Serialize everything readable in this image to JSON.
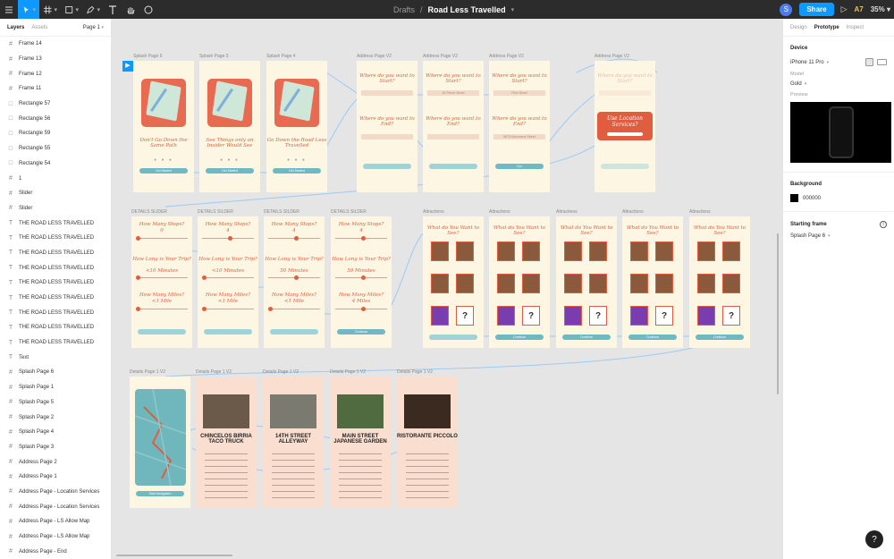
{
  "topbar": {
    "breadcrumb_parent": "Drafts",
    "separator": "/",
    "file_title": "Road Less Travelled",
    "avatar_letter": "S",
    "share_label": "Share",
    "play_glyph": "▷",
    "user_initials": "A7",
    "zoom": "35%"
  },
  "left_panel": {
    "tabs": [
      "Layers",
      "Assets"
    ],
    "page_select": "Page 1",
    "layers": [
      {
        "icon": "frame",
        "label": "Frame 14"
      },
      {
        "icon": "frame",
        "label": "Frame 13"
      },
      {
        "icon": "frame",
        "label": "Frame 12"
      },
      {
        "icon": "frame",
        "label": "Frame 11"
      },
      {
        "icon": "rect",
        "label": "Rectangle 57"
      },
      {
        "icon": "rect",
        "label": "Rectangle 56"
      },
      {
        "icon": "rect",
        "label": "Rectangle 59"
      },
      {
        "icon": "rect",
        "label": "Rectangle 55"
      },
      {
        "icon": "rect",
        "label": "Rectangle 54"
      },
      {
        "icon": "frame",
        "label": "1"
      },
      {
        "icon": "frame",
        "label": "Slider"
      },
      {
        "icon": "frame",
        "label": "Slider"
      },
      {
        "icon": "text",
        "label": "THE ROAD LESS TRAVELLED"
      },
      {
        "icon": "text",
        "label": "THE ROAD LESS TRAVELLED"
      },
      {
        "icon": "text",
        "label": "THE ROAD LESS TRAVELLED"
      },
      {
        "icon": "text",
        "label": "THE ROAD LESS TRAVELLED"
      },
      {
        "icon": "text",
        "label": "THE ROAD LESS TRAVELLED"
      },
      {
        "icon": "text",
        "label": "THE ROAD LESS TRAVELLED"
      },
      {
        "icon": "text",
        "label": "THE ROAD LESS TRAVELLED"
      },
      {
        "icon": "text",
        "label": "THE ROAD LESS TRAVELLED"
      },
      {
        "icon": "text",
        "label": "THE ROAD LESS TRAVELLED"
      },
      {
        "icon": "text",
        "label": "Text"
      },
      {
        "icon": "frame",
        "label": "Splash Page 6"
      },
      {
        "icon": "frame",
        "label": "Splash Page 1"
      },
      {
        "icon": "frame",
        "label": "Splash Page 5"
      },
      {
        "icon": "frame",
        "label": "Splash Page 2"
      },
      {
        "icon": "frame",
        "label": "Splash Page 4"
      },
      {
        "icon": "frame",
        "label": "Splash Page 3"
      },
      {
        "icon": "frame",
        "label": "Address Page 2"
      },
      {
        "icon": "frame",
        "label": "Address Page 1"
      },
      {
        "icon": "frame",
        "label": "Address Page - Location Services"
      },
      {
        "icon": "frame",
        "label": "Address Page - Location Services"
      },
      {
        "icon": "frame",
        "label": "Address Page - LS Allow Map"
      },
      {
        "icon": "frame",
        "label": "Address Page - LS Allow Map"
      },
      {
        "icon": "frame",
        "label": "Address Page - End"
      }
    ]
  },
  "canvas": {
    "row1": [
      {
        "label": "Splash Page 6",
        "caption": "Don't Go Down the Same Path",
        "button": "Get Started"
      },
      {
        "label": "Splash Page 5",
        "caption": "See Things only an Insider Would See",
        "button": "Get Started"
      },
      {
        "label": "Splash Page 4",
        "caption": "Go Down the Road Less Travelled",
        "button": "Get Started"
      }
    ],
    "address_frames": [
      {
        "label": "Address Page V2",
        "q1": "Where do you want to Start?",
        "q2": "Where do you want to End?",
        "v1": "",
        "v2": "",
        "button": ""
      },
      {
        "label": "Address Page V2",
        "q1": "Where do you want to Start?",
        "q2": "Where do you want to End?",
        "v1": "20 Pierce Street",
        "v2": "",
        "button": ""
      },
      {
        "label": "Address Page V2",
        "q1": "Where do you want to Start?",
        "q2": "Where do you want to End?",
        "v1": "Pine Street",
        "v2": "9873 Monument Street",
        "button": "Go!"
      }
    ],
    "location_frame": {
      "label": "Address Page V2",
      "q1": "Where do you want to Start?",
      "popup": "Use Location Services?"
    },
    "details_frames": [
      {
        "label": "DETAILS SLIDER",
        "q1": "How Many Stops?",
        "v1": "0",
        "q2": "How Long is Your Trip?",
        "v2": "<10 Minutes",
        "q3": "How Many Miles?",
        "v3": "<1 Mile",
        "button": "",
        "s1": 0.0,
        "s2": 0.0,
        "s3": 0.0
      },
      {
        "label": "DETAILS SILDER",
        "q1": "How Many Stops?",
        "v1": "4",
        "q2": "How Long is Your Trip?",
        "v2": "<10 Minutes",
        "q3": "How Many Miles?",
        "v3": "<1 Mile",
        "button": "",
        "s1": 0.5,
        "s2": 0.0,
        "s3": 0.0
      },
      {
        "label": "DETAILS SILDER",
        "q1": "How Many Stops?",
        "v1": "4",
        "q2": "How Long is Your Trip?",
        "v2": "50 Minutes",
        "q3": "How Many Miles?",
        "v3": "<1 Mile",
        "button": "",
        "s1": 0.5,
        "s2": 0.5,
        "s3": 0.0
      },
      {
        "label": "DETAILS SILDER",
        "q1": "How Many Stops?",
        "v1": "4",
        "q2": "How Long is Your Trip?",
        "v2": "50 Minutes",
        "q3": "How Many Miles?",
        "v3": "4 Miles",
        "button": "Continue",
        "s1": 0.5,
        "s2": 0.5,
        "s3": 0.5
      }
    ],
    "attractions_frames": [
      {
        "label": "Attractions",
        "title": "What do You Want to See?",
        "button": ""
      },
      {
        "label": "Attractions",
        "title": "What do You Want to See?",
        "button": "Continue"
      },
      {
        "label": "Attractions",
        "title": "What do You Want to See?",
        "button": "Continue"
      },
      {
        "label": "Attractions",
        "title": "What do You Want to See?",
        "button": "Continue"
      },
      {
        "label": "Attractions",
        "title": "What do You Want to See?",
        "button": "Continue"
      }
    ],
    "detail_pages": [
      {
        "label": "Details Page 1 V2",
        "title": "",
        "button": "Start Navigation"
      },
      {
        "label": "Details Page 1 V2",
        "title": "CHINCELOS BIRRIA TACO TRUCK",
        "button": ""
      },
      {
        "label": "Details Page 1 V2",
        "title": "14TH STREET ALLEYWAY",
        "button": ""
      },
      {
        "label": "Details Page 1 V2",
        "title": "MAIN STREET JAPANESE GARDEN",
        "button": ""
      },
      {
        "label": "Details Page 1 V2",
        "title": "RISTORANTE PICCOLO",
        "button": ""
      }
    ]
  },
  "right_panel": {
    "tabs": [
      "Design",
      "Prototype",
      "Inspect"
    ],
    "active_tab": "Prototype",
    "device_heading": "Device",
    "device": "iPhone 11 Pro",
    "model_label": "Model",
    "model": "Gold",
    "preview_label": "Preview",
    "background_heading": "Background",
    "background_value": "000000",
    "starting_frame_heading": "Starting frame",
    "starting_frame": "Splash Page 6",
    "help": "?"
  },
  "colors": {
    "accent": "#0d99ff",
    "brand_orange": "#e05d40",
    "teal": "#9fd3d8",
    "frame_bg": "#fdf6e3"
  }
}
